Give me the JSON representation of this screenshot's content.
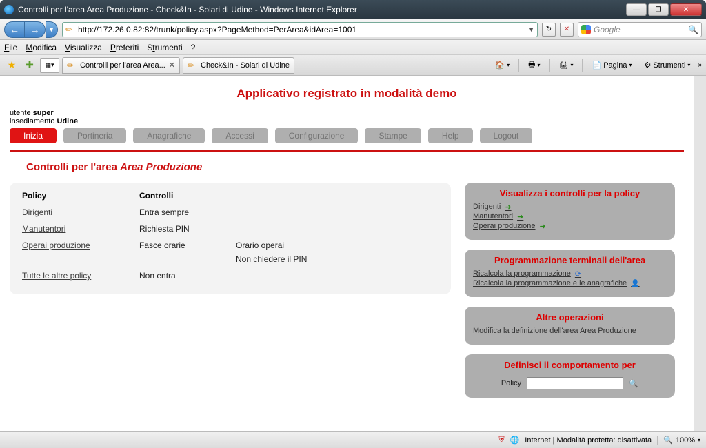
{
  "window": {
    "title": "Controlli per l'area Area Produzione - Check&In - Solari di Udine - Windows Internet Explorer",
    "buttons": {
      "min": "—",
      "max": "❐",
      "close": "✕"
    }
  },
  "nav": {
    "url": "http://172.26.0.82:82/trunk/policy.aspx?PageMethod=PerArea&idArea=1001",
    "refresh": "↻",
    "stop": "✕",
    "search_placeholder": "Google",
    "back": "←",
    "fwd": "→",
    "dd": "▼"
  },
  "menus": [
    "File",
    "Modifica",
    "Visualizza",
    "Preferiti",
    "Strumenti",
    "?"
  ],
  "tabs": [
    {
      "label": "Controlli per l'area Area..."
    },
    {
      "label": "Check&In - Solari di Udine"
    }
  ],
  "toolbar": {
    "pagina": "Pagina",
    "strumenti": "Strumenti",
    "caret": "▾"
  },
  "demo_banner": "Applicativo registrato in modalità demo",
  "user": {
    "prefix": "utente ",
    "name": "super",
    "site_prefix": "insediamento ",
    "site": "Udine"
  },
  "nav_buttons": [
    "Inizia",
    "Portineria",
    "Anagrafiche",
    "Accessi",
    "Configurazione",
    "Stampe",
    "Help",
    "Logout"
  ],
  "page_title_prefix": "Controlli per l'area ",
  "page_title_area": "Area Produzione",
  "left": {
    "headers": {
      "policy": "Policy",
      "controlli": "Controlli"
    },
    "rows": [
      {
        "policy": "Dirigenti",
        "controlli": [
          "Entra sempre"
        ]
      },
      {
        "policy": "Manutentori",
        "controlli": [
          "Richiesta PIN"
        ]
      },
      {
        "policy": "Operai produzione",
        "controlli": [
          "Fasce orarie"
        ],
        "extra": [
          "Orario operai",
          "Non chiedere il PIN"
        ]
      },
      {
        "policy": "Tutte le altre policy",
        "controlli": [
          "Non entra"
        ]
      }
    ]
  },
  "right": {
    "panel1": {
      "title": "Visualizza i controlli per la policy",
      "links": [
        "Dirigenti",
        "Manutentori",
        "Operai produzione"
      ]
    },
    "panel2": {
      "title": "Programmazione terminali dell'area",
      "links": [
        "Ricalcola la programmazione",
        "Ricalcola la programmazione e le anagrafiche"
      ]
    },
    "panel3": {
      "title": "Altre operazioni",
      "links": [
        "Modifica la definizione dell'area Area Produzione"
      ]
    },
    "panel4": {
      "title": "Definisci il comportamento per",
      "policy_label": "Policy"
    }
  },
  "status": {
    "text": "Internet | Modalità protetta: disattivata",
    "zoom": "100%"
  }
}
